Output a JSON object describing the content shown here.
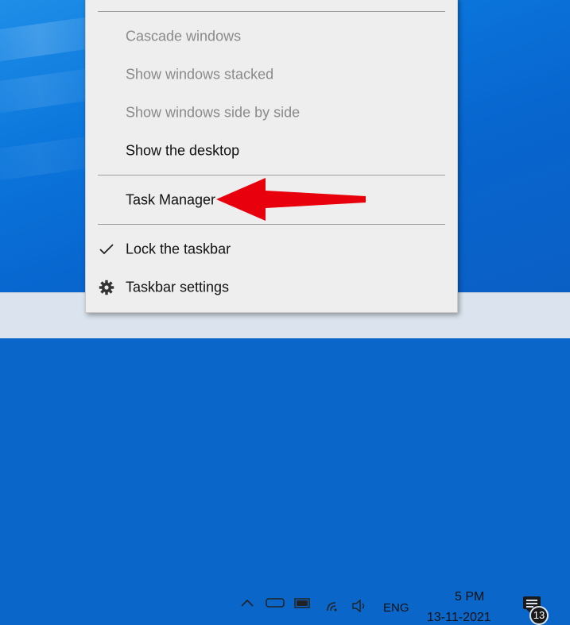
{
  "menu": {
    "items": [
      {
        "label": "Cascade windows",
        "enabled": false
      },
      {
        "label": "Show windows stacked",
        "enabled": false
      },
      {
        "label": "Show windows side by side",
        "enabled": false
      },
      {
        "label": "Show the desktop",
        "enabled": true
      },
      {
        "label": "Task Manager",
        "enabled": true
      },
      {
        "label": "Lock the taskbar",
        "enabled": true,
        "checked": true
      },
      {
        "label": "Taskbar settings",
        "enabled": true,
        "icon": "gear-icon"
      }
    ]
  },
  "taskbar": {
    "language": "ENG",
    "time": "5 PM",
    "date": "13-11-2021",
    "notification_count": "13"
  },
  "annotation": {
    "arrow_color": "#e8000d"
  }
}
